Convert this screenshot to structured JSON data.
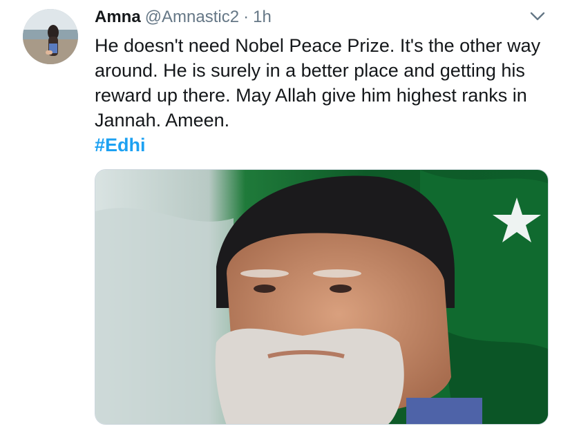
{
  "tweet": {
    "author_name": "Amna",
    "handle": "@Amnastic2",
    "separator": "·",
    "time": "1h",
    "text": "He doesn't need Nobel Peace Prize. It's the other way around. He is surely in a better place and getting his reward up there. May Allah give him highest ranks in Jannah. Ameen.",
    "hashtag": "#Edhi"
  },
  "icons": {
    "menu": "chevron-down-icon"
  },
  "colors": {
    "link": "#1da1f2",
    "secondary_text": "#657786",
    "flag_green": "#0f6b2e",
    "flag_white": "#e8eeee"
  }
}
